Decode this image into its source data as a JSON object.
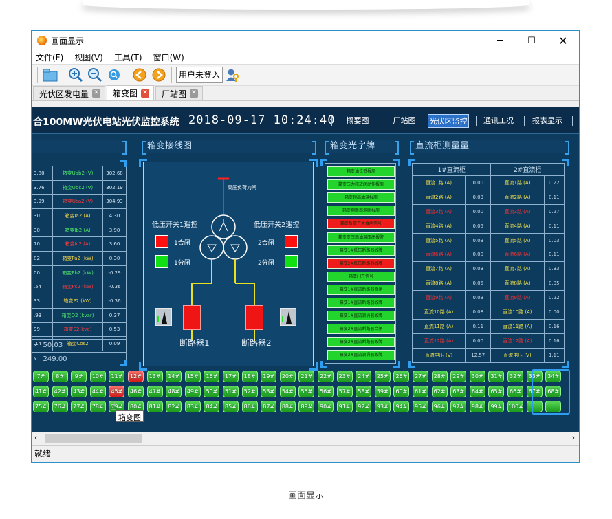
{
  "window": {
    "title": "画面显示"
  },
  "menu": [
    "文件(F)",
    "视图(V)",
    "工具(T)",
    "窗口(W)"
  ],
  "toolbar": {
    "login_label": "用户未登入"
  },
  "tabs": [
    {
      "label": "光伏区发电量"
    },
    {
      "label": "箱变图"
    },
    {
      "label": "厂站图"
    }
  ],
  "header": {
    "title": "合100MW光伏电站光伏监控系统",
    "clock": "2018-09-17 10:24:40",
    "nav": [
      "概要图",
      "厂站图",
      "光伏区监控",
      "通讯工况",
      "报表显示"
    ]
  },
  "sections": {
    "diagram": "箱变接线图",
    "signals": "箱变光字牌",
    "dc": "直流柜测量量"
  },
  "measurements": [
    {
      "left": "3.80",
      "label": "箱变Uab2 (V)",
      "value": "302.68",
      "lc": "grn"
    },
    {
      "left": "3.76",
      "label": "箱变Ubc2 (V)",
      "value": "302.19",
      "lc": "grn"
    },
    {
      "left": "3.99",
      "label": "箱变Uca2 (V)",
      "value": "304.93",
      "lc": "red"
    },
    {
      "left": "30",
      "label": "箱变Ia2 (A)",
      "value": "4.30",
      "lc": "lbl"
    },
    {
      "left": "30",
      "label": "箱变Ib2 (A)",
      "value": "3.90",
      "lc": "grn"
    },
    {
      "left": "70",
      "label": "箱变Ic2 (A)",
      "value": "3.60",
      "lc": "red"
    },
    {
      "left": "82",
      "label": "箱变Pa2 (kW)",
      "value": "0.30",
      "lc": "lbl"
    },
    {
      "left": "00",
      "label": "箱变Pb2 (kW)",
      "value": "-0.29",
      "lc": "grn"
    },
    {
      "left": ".54",
      "label": "箱变Pc2 (kW)",
      "value": "-0.36",
      "lc": "red"
    },
    {
      "left": "33",
      "label": "箱变P2 (kW)",
      "value": "-0.36",
      "lc": "lbl"
    },
    {
      "left": ".93",
      "label": "箱变Q2 (kvar)",
      "value": "0.37",
      "lc": "grn"
    },
    {
      "left": "99",
      "label": "箱变S2(kva)",
      "value": "0.53",
      "lc": "red"
    },
    {
      "left": ".14",
      "label": "箱变Cos2",
      "value": "0.09",
      "lc": "lbl"
    }
  ],
  "big_values": [
    "50.03",
    "249.00"
  ],
  "diagram": {
    "load_switch": "高压负荷刀闸",
    "lv_left": "低压开关1遥控",
    "lv_right": "低压开关2遥控",
    "close1": "1合闸",
    "open1": "1分闸",
    "close2": "2合闸",
    "open2": "2分闸",
    "breaker1": "断路器1",
    "breaker2": "断路器2"
  },
  "signals": [
    {
      "text": "箱变油位低报周",
      "state": "g"
    },
    {
      "text": "箱变压力释放阀动作报周",
      "state": "g"
    },
    {
      "text": "箱变超高油温报周",
      "state": "g"
    },
    {
      "text": "箱变熔断器熔断报周",
      "state": "g"
    },
    {
      "text": "箱变负荷开关合闸信号",
      "state": "r"
    },
    {
      "text": "箱变变压器油温压高报警",
      "state": "g"
    },
    {
      "text": "箱变1#低压断路器故障",
      "state": "g"
    },
    {
      "text": "箱变2#低压断路器故障",
      "state": "r"
    },
    {
      "text": "箱变门开信号",
      "state": "g"
    },
    {
      "text": "箱变1#直流断路器合闸",
      "state": "g"
    },
    {
      "text": "箱变1#直流断路器故障",
      "state": "g"
    },
    {
      "text": "箱变1#直流浪涌器故障",
      "state": "g"
    },
    {
      "text": "箱变2#直流断路器合闸",
      "state": "g"
    },
    {
      "text": "箱变2#直流断路器故障",
      "state": "g"
    },
    {
      "text": "箱变2#直流浪涌器故障",
      "state": "g"
    }
  ],
  "dc": {
    "headers": [
      "1#直流柜",
      "2#直流柜"
    ],
    "rows": [
      {
        "l1": "直流1路 (A)",
        "v1": "0.00",
        "c1": "gl",
        "l2": "直流1路 (A)",
        "v2": "0.22",
        "c2": "gl"
      },
      {
        "l1": "直流2路 (A)",
        "v1": "0.03",
        "c1": "gl",
        "l2": "直流2路 (A)",
        "v2": "0.11",
        "c2": "gl"
      },
      {
        "l1": "直流3路 (A)",
        "v1": "0.00",
        "c1": "rl",
        "l2": "直流3路 (A)",
        "v2": "0.27",
        "c2": "rl"
      },
      {
        "l1": "直流4路 (A)",
        "v1": "0.05",
        "c1": "gl",
        "l2": "直流4路 (A)",
        "v2": "0.11",
        "c2": "gl"
      },
      {
        "l1": "直流5路 (A)",
        "v1": "0.03",
        "c1": "gl",
        "l2": "直流5路 (A)",
        "v2": "0.03",
        "c2": "gl"
      },
      {
        "l1": "直流6路 (A)",
        "v1": "0.00",
        "c1": "rl",
        "l2": "直流6路 (A)",
        "v2": "0.11",
        "c2": "rl"
      },
      {
        "l1": "直流7路 (A)",
        "v1": "0.03",
        "c1": "gl",
        "l2": "直流7路 (A)",
        "v2": "0.33",
        "c2": "gl"
      },
      {
        "l1": "直流8路 (A)",
        "v1": "0.05",
        "c1": "gl",
        "l2": "直流8路 (A)",
        "v2": "0.05",
        "c2": "gl"
      },
      {
        "l1": "直流9路 (A)",
        "v1": "0.03",
        "c1": "rl",
        "l2": "直流9路 (A)",
        "v2": "0.22",
        "c2": "rl"
      },
      {
        "l1": "直流10路 (A)",
        "v1": "0.08",
        "c1": "gl",
        "l2": "直流10路 (A)",
        "v2": "0.00",
        "c2": "gl"
      },
      {
        "l1": "直流11路 (A)",
        "v1": "0.11",
        "c1": "gl",
        "l2": "直流11路 (A)",
        "v2": "0.16",
        "c2": "gl"
      },
      {
        "l1": "直流12路 (A)",
        "v1": "0.00",
        "c1": "rl",
        "l2": "直流12路 (A)",
        "v2": "0.16",
        "c2": "rl"
      },
      {
        "l1": "直流电压 (V)",
        "v1": "12.57",
        "c1": "gl",
        "l2": "直流电压 (V)",
        "v2": "1.11",
        "c2": "gl"
      }
    ]
  },
  "units": {
    "rows": [
      [
        "7#",
        "8#",
        "9#",
        "10#",
        "11#",
        "12#",
        "13#",
        "14#",
        "15#",
        "16#",
        "17#",
        "18#",
        "19#",
        "20#",
        "21#",
        "22#",
        "23#",
        "24#",
        "25#",
        "26#",
        "27#",
        "28#",
        "29#",
        "30#",
        "31#",
        "32#",
        "33#",
        "34#"
      ],
      [
        "41#",
        "42#",
        "43#",
        "44#",
        "45#",
        "46#",
        "47#",
        "48#",
        "49#",
        "50#",
        "51#",
        "52#",
        "53#",
        "54#",
        "55#",
        "56#",
        "57#",
        "58#",
        "59#",
        "60#",
        "61#",
        "62#",
        "63#",
        "64#",
        "65#",
        "66#",
        "67#",
        "68#"
      ],
      [
        "75#",
        "76#",
        "77#",
        "78#",
        "79#",
        "80#",
        "81#",
        "82#",
        "83#",
        "84#",
        "85#",
        "86#",
        "87#",
        "88#",
        "89#",
        "90#",
        "91#",
        "92#",
        "93#",
        "94#",
        "95#",
        "96#",
        "97#",
        "98#",
        "99#",
        "100#",
        "",
        ""
      ]
    ],
    "red": [
      "12#",
      "45#"
    ]
  },
  "tooltip": "箱变图",
  "status": "就绪",
  "caption": "画面显示"
}
